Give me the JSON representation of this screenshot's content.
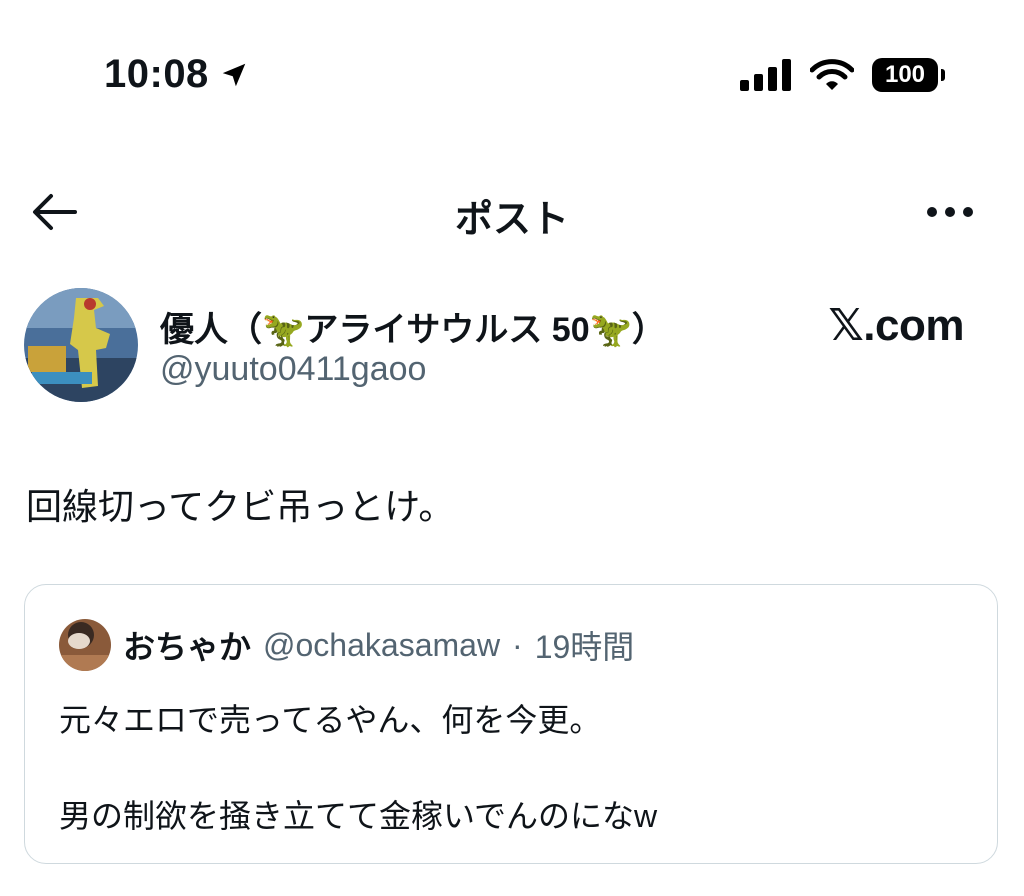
{
  "status_bar": {
    "time": "10:08",
    "battery": "100"
  },
  "header": {
    "title": "ポスト"
  },
  "author": {
    "name": "優人（🦖アライサウルス 50🦖）",
    "handle": "@yuuto0411gaoo"
  },
  "watermark": "𝕏.com",
  "post": {
    "text": "回線切ってクビ吊っとけ。"
  },
  "quote": {
    "name": "おちゃか",
    "handle": "@ochakasamaw",
    "separator": "·",
    "time": "19時間",
    "line1": "元々エロで売ってるやん、何を今更。",
    "line2": "男の制欲を掻き立てて金稼いでんのになw"
  },
  "icons": {
    "location": "location-arrow-icon",
    "signal": "cellular-signal-icon",
    "wifi": "wifi-icon",
    "battery": "battery-icon",
    "back": "arrow-left-icon",
    "more": "more-horizontal-icon"
  }
}
